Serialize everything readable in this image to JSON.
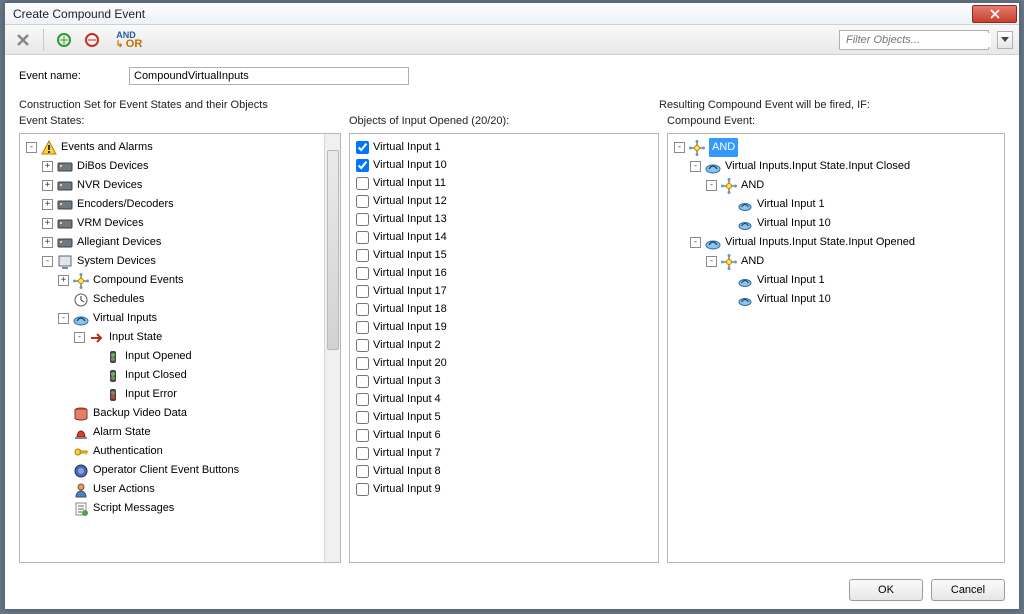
{
  "window": {
    "title": "Create Compound Event"
  },
  "toolbar": {
    "delete_icon": "delete-icon",
    "add_green_icon": "add-green-icon",
    "add_red_icon": "add-red-icon",
    "and_label": "AND",
    "or_label": "OR",
    "filter_placeholder": "Filter Objects..."
  },
  "labels": {
    "event_name": "Event name:",
    "construction_set": "Construction Set for Event States and their Objects",
    "event_states": "Event States:",
    "objects_header": "Objects of Input Opened (20/20):",
    "resulting_header": "Resulting Compound Event will be fired, IF:",
    "compound_event_header": "Compound Event:"
  },
  "event_name_value": "CompoundVirtualInputs",
  "event_states_tree": [
    {
      "lvl": 0,
      "exp": "-",
      "icon": "alert-icon",
      "label": "Events and Alarms"
    },
    {
      "lvl": 1,
      "exp": "+",
      "icon": "device-icon",
      "label": "DiBos Devices"
    },
    {
      "lvl": 1,
      "exp": "+",
      "icon": "device-icon",
      "label": "NVR Devices"
    },
    {
      "lvl": 1,
      "exp": "+",
      "icon": "device-icon",
      "label": "Encoders/Decoders"
    },
    {
      "lvl": 1,
      "exp": "+",
      "icon": "device-icon",
      "label": "VRM Devices"
    },
    {
      "lvl": 1,
      "exp": "+",
      "icon": "device-icon",
      "label": "Allegiant Devices"
    },
    {
      "lvl": 1,
      "exp": "-",
      "icon": "system-icon",
      "label": "System Devices"
    },
    {
      "lvl": 2,
      "exp": "+",
      "icon": "compound-icon",
      "label": "Compound Events"
    },
    {
      "lvl": 2,
      "exp": " ",
      "icon": "clock-icon",
      "label": "Schedules"
    },
    {
      "lvl": 2,
      "exp": "-",
      "icon": "vinput-icon",
      "label": "Virtual Inputs"
    },
    {
      "lvl": 3,
      "exp": "-",
      "icon": "arrow-icon",
      "label": "Input State"
    },
    {
      "lvl": 4,
      "exp": " ",
      "icon": "signal-green-icon",
      "label": "Input Opened"
    },
    {
      "lvl": 4,
      "exp": " ",
      "icon": "signal-green-icon",
      "label": "Input Closed"
    },
    {
      "lvl": 4,
      "exp": " ",
      "icon": "signal-red-icon",
      "label": "Input Error"
    },
    {
      "lvl": 2,
      "exp": " ",
      "icon": "db-icon",
      "label": "Backup Video Data"
    },
    {
      "lvl": 2,
      "exp": " ",
      "icon": "alarm-icon",
      "label": "Alarm State"
    },
    {
      "lvl": 2,
      "exp": " ",
      "icon": "key-icon",
      "label": "Authentication"
    },
    {
      "lvl": 2,
      "exp": " ",
      "icon": "button-icon",
      "label": "Operator Client Event Buttons"
    },
    {
      "lvl": 2,
      "exp": " ",
      "icon": "user-icon",
      "label": "User Actions"
    },
    {
      "lvl": 2,
      "exp": " ",
      "icon": "script-icon",
      "label": "Script Messages"
    }
  ],
  "objects": [
    {
      "label": "Virtual Input 1",
      "checked": true
    },
    {
      "label": "Virtual Input 10",
      "checked": true
    },
    {
      "label": "Virtual Input 11",
      "checked": false
    },
    {
      "label": "Virtual Input 12",
      "checked": false
    },
    {
      "label": "Virtual Input 13",
      "checked": false
    },
    {
      "label": "Virtual Input 14",
      "checked": false
    },
    {
      "label": "Virtual Input 15",
      "checked": false
    },
    {
      "label": "Virtual Input 16",
      "checked": false
    },
    {
      "label": "Virtual Input 17",
      "checked": false
    },
    {
      "label": "Virtual Input 18",
      "checked": false
    },
    {
      "label": "Virtual Input 19",
      "checked": false
    },
    {
      "label": "Virtual Input 2",
      "checked": false
    },
    {
      "label": "Virtual Input 20",
      "checked": false
    },
    {
      "label": "Virtual Input 3",
      "checked": false
    },
    {
      "label": "Virtual Input 4",
      "checked": false
    },
    {
      "label": "Virtual Input 5",
      "checked": false
    },
    {
      "label": "Virtual Input 6",
      "checked": false
    },
    {
      "label": "Virtual Input 7",
      "checked": false
    },
    {
      "label": "Virtual Input 8",
      "checked": false
    },
    {
      "label": "Virtual Input 9",
      "checked": false
    }
  ],
  "compound_tree": [
    {
      "lvl": 0,
      "exp": "-",
      "icon": "compound-icon",
      "label": "AND",
      "selected": true
    },
    {
      "lvl": 1,
      "exp": "-",
      "icon": "vinput-icon",
      "label": "Virtual Inputs.Input State.Input Closed"
    },
    {
      "lvl": 2,
      "exp": "-",
      "icon": "compound-icon",
      "label": "AND"
    },
    {
      "lvl": 3,
      "exp": " ",
      "icon": "vinput-small-icon",
      "label": "Virtual Input 1"
    },
    {
      "lvl": 3,
      "exp": " ",
      "icon": "vinput-small-icon",
      "label": "Virtual Input 10"
    },
    {
      "lvl": 1,
      "exp": "-",
      "icon": "vinput-icon",
      "label": "Virtual Inputs.Input State.Input Opened"
    },
    {
      "lvl": 2,
      "exp": "-",
      "icon": "compound-icon",
      "label": "AND"
    },
    {
      "lvl": 3,
      "exp": " ",
      "icon": "vinput-small-icon",
      "label": "Virtual Input 1"
    },
    {
      "lvl": 3,
      "exp": " ",
      "icon": "vinput-small-icon",
      "label": "Virtual Input 10"
    }
  ],
  "buttons": {
    "ok": "OK",
    "cancel": "Cancel"
  }
}
